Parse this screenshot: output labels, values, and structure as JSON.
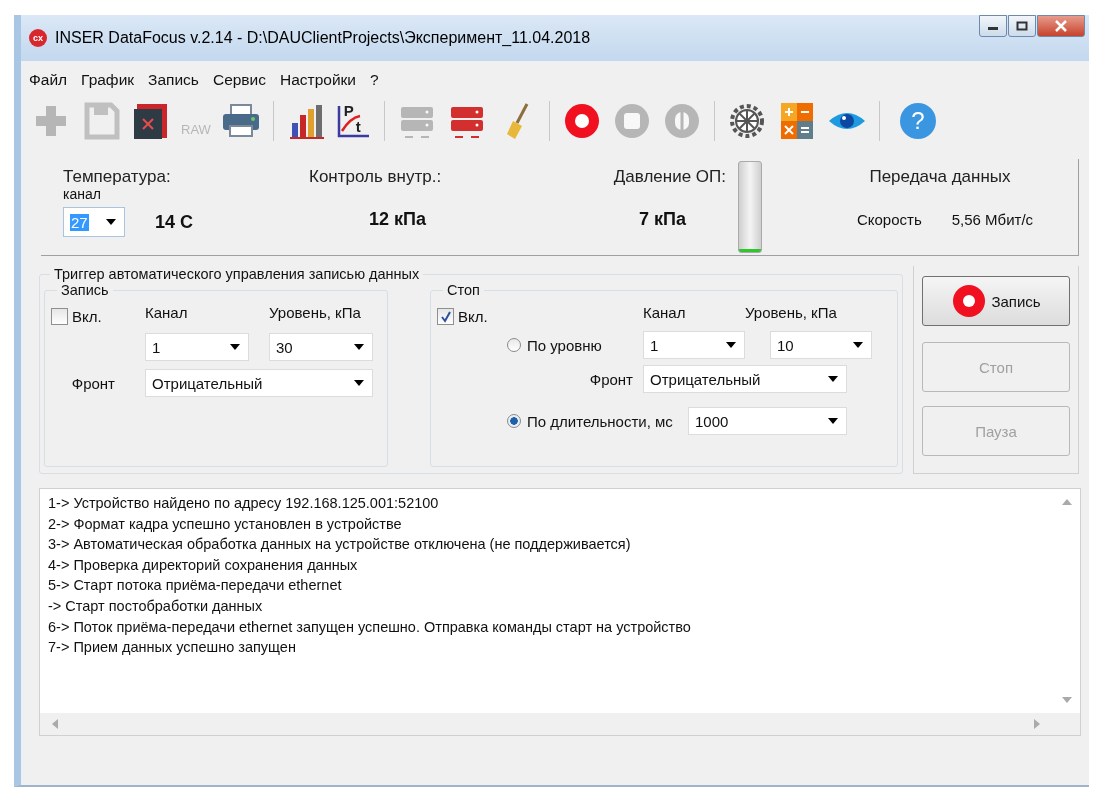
{
  "window": {
    "app_icon": "cx",
    "title": "INSER DataFocus v.2.14 - D:\\DAUClientProjects\\Эксперимент_11.04.2018"
  },
  "menu": [
    "Файл",
    "График",
    "Запись",
    "Сервис",
    "Настройки",
    "?"
  ],
  "toolbar": [
    [
      {
        "kind": "add",
        "disabled": true
      },
      {
        "kind": "save",
        "disabled": true
      },
      {
        "kind": "close-file",
        "disabled": false
      },
      {
        "kind": "raw",
        "label": "RAW",
        "disabled": true
      },
      {
        "kind": "print",
        "disabled": false
      }
    ],
    [
      {
        "kind": "bar-chart",
        "disabled": false
      },
      {
        "kind": "pt-chart",
        "label": "P",
        "sub": "t",
        "disabled": false
      }
    ],
    [
      {
        "kind": "device",
        "disabled": true
      },
      {
        "kind": "device",
        "disabled": false
      },
      {
        "kind": "broom",
        "disabled": false
      }
    ],
    [
      {
        "kind": "record",
        "disabled": false
      },
      {
        "kind": "stop",
        "disabled": true
      },
      {
        "kind": "pause",
        "disabled": true
      }
    ],
    [
      {
        "kind": "gear",
        "disabled": false
      },
      {
        "kind": "calculator",
        "disabled": false
      },
      {
        "kind": "eye",
        "disabled": false
      }
    ],
    [
      {
        "kind": "help",
        "label": "?",
        "disabled": false
      }
    ]
  ],
  "readings": {
    "temperature": {
      "label": "Температура:",
      "sublabel": "канал",
      "channel": "27",
      "value": "14 C"
    },
    "control": {
      "label": "Контроль внутр.:",
      "value": "12 кПа"
    },
    "pressure": {
      "label": "Давление ОП:",
      "value": "7 кПа",
      "level": 0.03
    },
    "transfer": {
      "label": "Передача данных",
      "speed_label": "Скорость",
      "speed": "5,56 Мбит/с"
    }
  },
  "trigger": {
    "title": "Триггер автоматического управления записью данных",
    "start": {
      "title": "Запись",
      "enable": {
        "label": "Вкл.",
        "checked": false
      },
      "channel_label": "Канал",
      "level_label": "Уровень, кПа",
      "channel": "1",
      "level": "30",
      "front_label": "Фронт",
      "front": "Отрицательный"
    },
    "stop": {
      "title": "Стоп",
      "enable": {
        "label": "Вкл.",
        "checked": true
      },
      "channel_label": "Канал",
      "level_label": "Уровень, кПа",
      "modes": [
        {
          "label": "По уровню",
          "selected": false
        },
        {
          "label": "По длительности, мс",
          "selected": true
        }
      ],
      "channel": "1",
      "level": "10",
      "front_label": "Фронт",
      "front": "Отрицательный",
      "duration": "1000"
    }
  },
  "buttons": [
    {
      "kind": "record",
      "label": "Запись",
      "disabled": false
    },
    {
      "kind": "plain",
      "label": "Стоп",
      "disabled": true
    },
    {
      "kind": "plain",
      "label": "Пауза",
      "disabled": true
    }
  ],
  "log": [
    "1-> Устройство найдено по адресу 192.168.125.001:52100",
    "2-> Формат кадра успешно установлен в устройстве",
    "3-> Автоматическая обработка данных на устройстве отключена (не поддерживается)",
    "4-> Проверка директорий сохранения данных",
    "5-> Старт потока приёма-передачи ethernet",
    "-> Старт постобработки данных",
    "6-> Поток приёма-передачи ethernet запущен успешно. Отправка команды старт на устройство",
    "7-> Прием данных успешно запущен"
  ]
}
